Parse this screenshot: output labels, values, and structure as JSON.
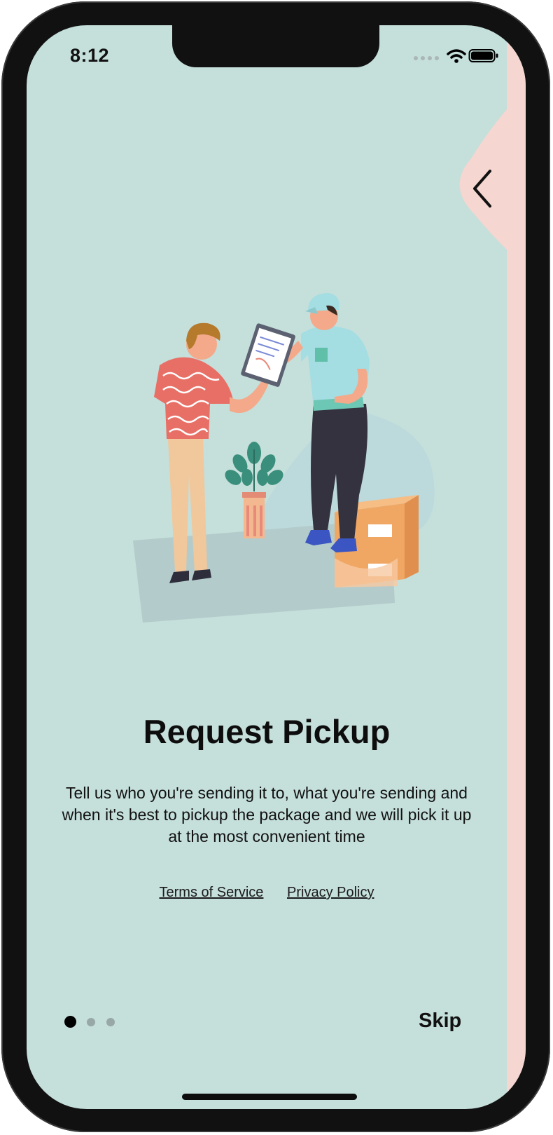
{
  "status_bar": {
    "time": "8:12",
    "icons": [
      "cellular-dots-icon",
      "wifi-icon",
      "battery-icon"
    ]
  },
  "onboarding": {
    "title": "Request Pickup",
    "description": "Tell us who you're sending it to, what you're sending and when it's best to pickup the package and we will pick it up at the most convenient time",
    "links": {
      "terms": "Terms of Service",
      "privacy": "Privacy Policy"
    },
    "pagination": {
      "total": 3,
      "current": 1
    },
    "skip_label": "Skip",
    "back_icon": "chevron-left-icon"
  },
  "colors": {
    "background": "#c5dfdb",
    "accent_strip": "#f5d6d0",
    "text": "#111111",
    "dot_inactive": "#97a8a6"
  }
}
